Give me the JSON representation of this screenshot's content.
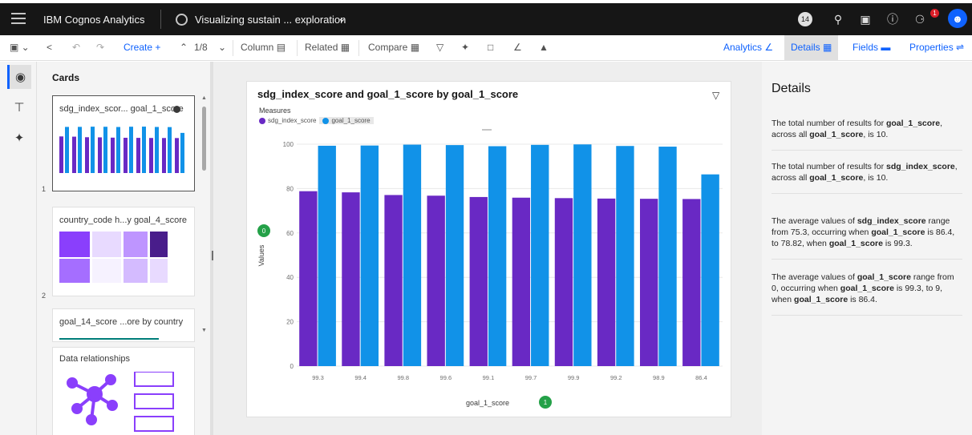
{
  "header": {
    "brand": "IBM Cognos Analytics",
    "report_title": "Visualizing sustain ... exploration",
    "user_count": "14",
    "notification_count": "1"
  },
  "toolbar": {
    "create_label": "Create",
    "page_indicator": "1/8",
    "column_label": "Column",
    "related_label": "Related",
    "compare_label": "Compare",
    "tabs": {
      "analytics": "Analytics",
      "details": "Details",
      "fields": "Fields",
      "properties": "Properties"
    }
  },
  "cards_panel": {
    "title": "Cards",
    "cards": [
      {
        "label": "sdg_index_scor... goal_1_score",
        "num": "1"
      },
      {
        "label": "country_code h...y goal_4_score",
        "num": "2"
      },
      {
        "label": "goal_14_score ...ore by country",
        "num": ""
      },
      {
        "label": "Data relationships",
        "num": ""
      }
    ]
  },
  "viz": {
    "title": "sdg_index_score and goal_1_score by goal_1_score",
    "legend_title": "Measures",
    "x_badge": "1",
    "y_badge": "0"
  },
  "chart_data": {
    "type": "bar",
    "title": "sdg_index_score and goal_1_score by goal_1_score",
    "xlabel": "goal_1_score",
    "ylabel": "Values",
    "categories": [
      "99.3",
      "99.4",
      "99.8",
      "99.6",
      "99.1",
      "99.7",
      "99.9",
      "99.2",
      "98.9",
      "86.4"
    ],
    "ylim": [
      0,
      100
    ],
    "yticks": [
      0,
      20,
      40,
      60,
      80,
      100
    ],
    "grid": true,
    "legend_position": "top-left",
    "series": [
      {
        "name": "sdg_index_score",
        "color": "#6929c4",
        "values": [
          78.82,
          78.3,
          77.1,
          76.8,
          76.2,
          75.9,
          75.7,
          75.5,
          75.4,
          75.3
        ]
      },
      {
        "name": "goal_1_score",
        "color": "#1192e8",
        "values": [
          99.3,
          99.4,
          99.8,
          99.6,
          99.1,
          99.7,
          99.9,
          99.2,
          98.9,
          86.4
        ]
      }
    ]
  },
  "details": {
    "title": "Details",
    "insights": [
      {
        "segments": [
          [
            "The total number of results for ",
            false
          ],
          [
            "goal_1_score",
            true
          ],
          [
            ", across all ",
            false
          ],
          [
            "goal_1_score",
            true
          ],
          [
            ", is 10.",
            false
          ]
        ]
      },
      {
        "segments": [
          [
            "The total number of results for ",
            false
          ],
          [
            "sdg_index_score",
            true
          ],
          [
            ", across all ",
            false
          ],
          [
            "goal_1_score",
            true
          ],
          [
            ", is 10.",
            false
          ]
        ]
      },
      {
        "segments": [
          [
            "The average values of ",
            false
          ],
          [
            "sdg_index_score",
            true
          ],
          [
            " range from 75.3, occurring when ",
            false
          ],
          [
            "goal_1_score",
            true
          ],
          [
            " is 86.4, to 78.82, when ",
            false
          ],
          [
            "goal_1_score",
            true
          ],
          [
            " is 99.3.",
            false
          ]
        ]
      },
      {
        "segments": [
          [
            "The average values of ",
            false
          ],
          [
            "goal_1_score",
            true
          ],
          [
            " range from 0, occurring when ",
            false
          ],
          [
            "goal_1_score",
            true
          ],
          [
            " is 99.3, to 9, when ",
            false
          ],
          [
            "goal_1_score",
            true
          ],
          [
            " is 86.4.",
            false
          ]
        ]
      }
    ]
  },
  "colors": {
    "accent": "#0f62fe",
    "purple": "#6929c4",
    "blue": "#1192e8",
    "badge_green": "#24a148"
  }
}
